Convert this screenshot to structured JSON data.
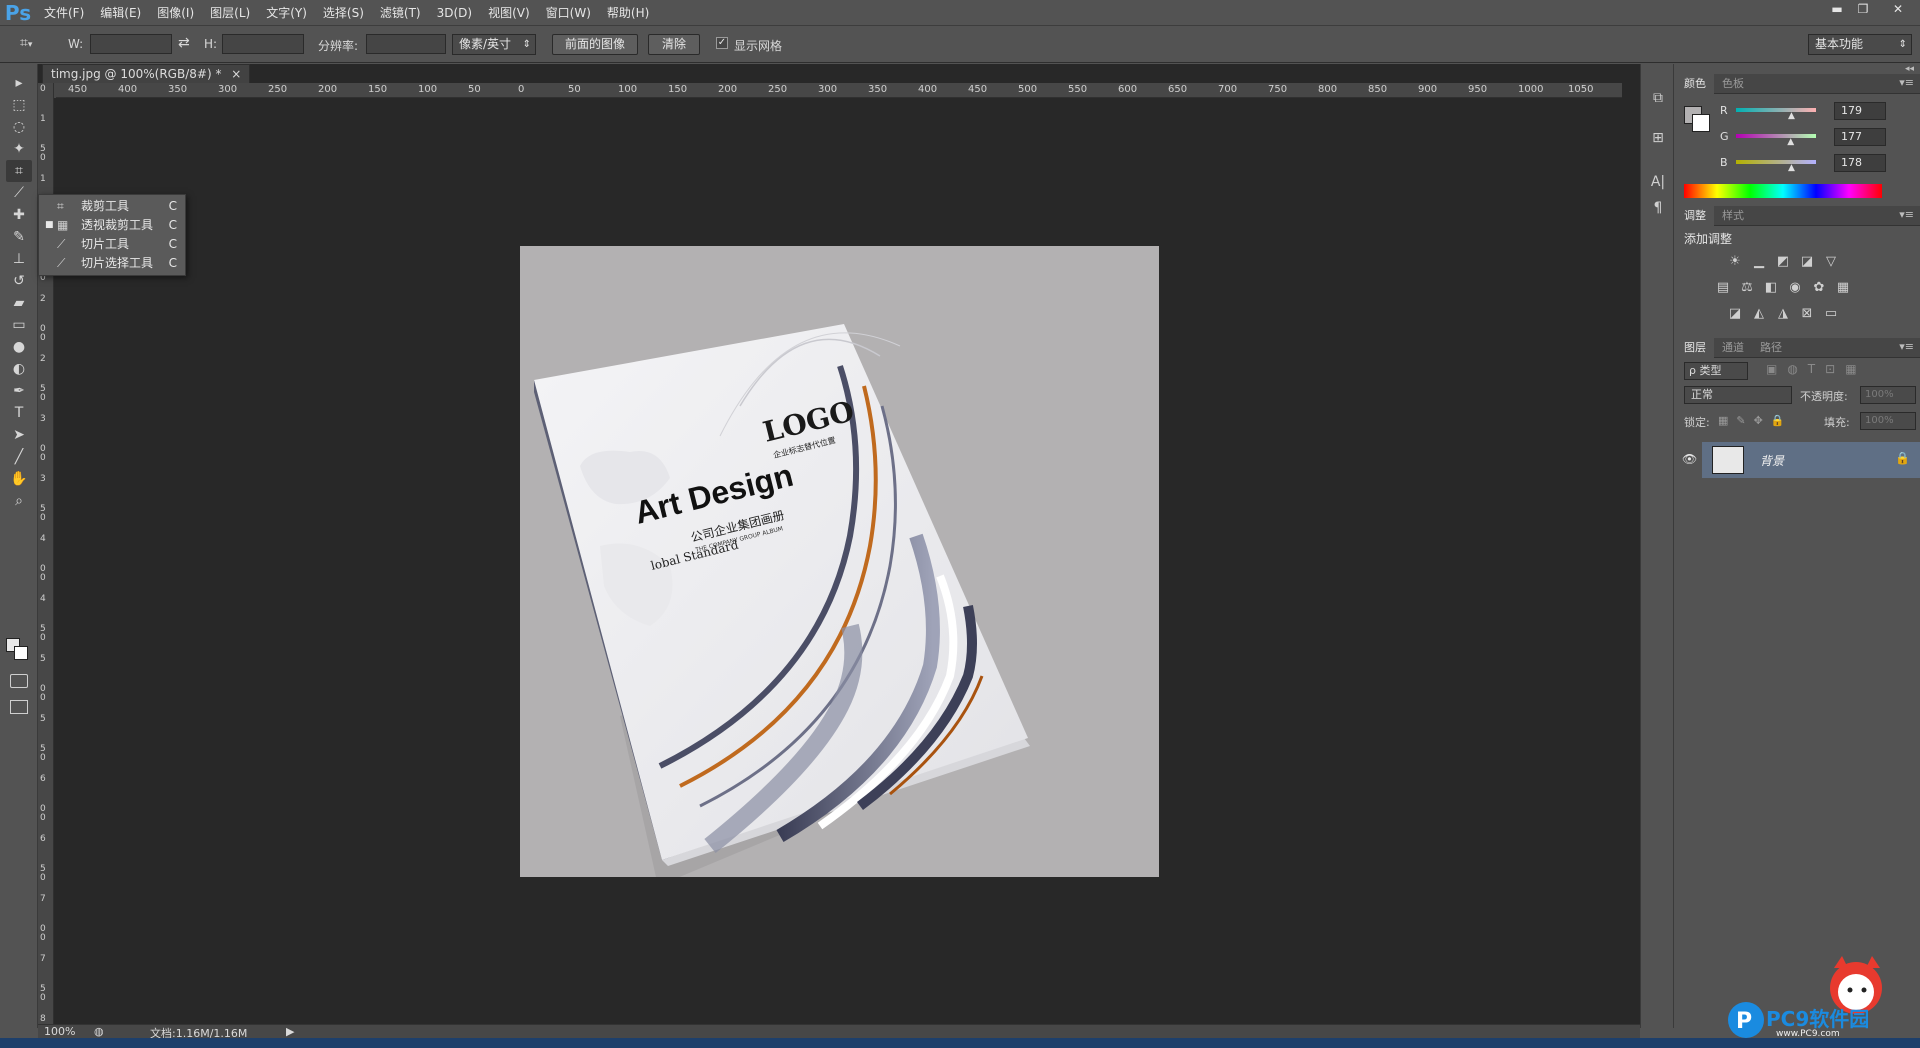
{
  "app": {
    "logo": "Ps"
  },
  "menu": [
    "文件(F)",
    "编辑(E)",
    "图像(I)",
    "图层(L)",
    "文字(Y)",
    "选择(S)",
    "滤镜(T)",
    "3D(D)",
    "视图(V)",
    "窗口(W)",
    "帮助(H)"
  ],
  "window_controls": {
    "minimize": "▬",
    "restore": "❐",
    "close": "✕"
  },
  "options": {
    "w_label": "W:",
    "h_label": "H:",
    "swap_glyph": "⇄",
    "resolution_label": "分辨率:",
    "unit_select": "像素/英寸",
    "front_image_button": "前面的图像",
    "clear_button": "清除",
    "show_grid_checked": "✓",
    "show_grid_label": "显示网格",
    "workspace": "基本功能"
  },
  "document": {
    "tab_title": "timg.jpg @ 100%(RGB/8#) *",
    "tab_close": "×",
    "ruler_top": [
      "450",
      "400",
      "350",
      "300",
      "250",
      "200",
      "150",
      "100",
      "50",
      "0",
      "50",
      "100",
      "150",
      "200",
      "250",
      "300",
      "350",
      "400",
      "450",
      "500",
      "550",
      "600",
      "650",
      "700",
      "750",
      "800",
      "850",
      "900",
      "950",
      "1000",
      "1050"
    ],
    "ruler_left": [
      "0",
      "1",
      "50",
      "1",
      "00",
      "1",
      "50",
      "2",
      "00",
      "2",
      "50",
      "3",
      "00",
      "3",
      "50",
      "4",
      "00",
      "4",
      "50",
      "5",
      "00",
      "5",
      "50",
      "6",
      "00",
      "6",
      "50",
      "7",
      "00",
      "7",
      "50",
      "8"
    ]
  },
  "cover": {
    "logo_text": "LOGO",
    "logo_sub": "企业标志替代位置",
    "title": "Art Design",
    "subtitle_cn": "公司企业集团画册",
    "subtitle_en": "THE COMPANY GROUP ALBUM",
    "tagline": "lobal Standard"
  },
  "flyout": [
    {
      "icon": "crop-icon",
      "glyph": "⌗",
      "label": "裁剪工具",
      "key": "C",
      "bullet": ""
    },
    {
      "icon": "perspective-crop-icon",
      "glyph": "▦",
      "label": "透视裁剪工具",
      "key": "C",
      "bullet": "■"
    },
    {
      "icon": "slice-icon",
      "glyph": "⟋",
      "label": "切片工具",
      "key": "C",
      "bullet": ""
    },
    {
      "icon": "slice-select-icon",
      "glyph": "⟋",
      "label": "切片选择工具",
      "key": "C",
      "bullet": ""
    }
  ],
  "tools": [
    {
      "name": "move-tool-icon",
      "glyph": "▸"
    },
    {
      "name": "marquee-tool-icon",
      "glyph": "⬚"
    },
    {
      "name": "lasso-tool-icon",
      "glyph": "◌"
    },
    {
      "name": "magic-wand-tool-icon",
      "glyph": "✦"
    },
    {
      "name": "crop-tool-icon",
      "glyph": "⌗"
    },
    {
      "name": "eyedropper-tool-icon",
      "glyph": "⟋"
    },
    {
      "name": "healing-brush-tool-icon",
      "glyph": "✚"
    },
    {
      "name": "brush-tool-icon",
      "glyph": "✎"
    },
    {
      "name": "stamp-tool-icon",
      "glyph": "⊥"
    },
    {
      "name": "history-brush-tool-icon",
      "glyph": "↺"
    },
    {
      "name": "eraser-tool-icon",
      "glyph": "▰"
    },
    {
      "name": "gradient-tool-icon",
      "glyph": "▭"
    },
    {
      "name": "blur-tool-icon",
      "glyph": "●"
    },
    {
      "name": "dodge-tool-icon",
      "glyph": "◐"
    },
    {
      "name": "pen-tool-icon",
      "glyph": "✒"
    },
    {
      "name": "type-tool-icon",
      "glyph": "T"
    },
    {
      "name": "path-selection-tool-icon",
      "glyph": "➤"
    },
    {
      "name": "line-tool-icon",
      "glyph": "╱"
    },
    {
      "name": "hand-tool-icon",
      "glyph": "✋"
    },
    {
      "name": "zoom-tool-icon",
      "glyph": "⌕"
    }
  ],
  "status": {
    "zoom": "100%",
    "doc": "文档:1.16M/1.16M",
    "arrow": "▶"
  },
  "panels": {
    "color_tabs": [
      "颜色",
      "色板"
    ],
    "panel_menu": "▾≡",
    "collapse": "◂◂",
    "r_label": "R",
    "g_label": "G",
    "b_label": "B",
    "r_value": "179",
    "g_value": "177",
    "b_value": "178",
    "r_level": 0.7,
    "g_level": 0.69,
    "b_level": 0.7,
    "fg_color": "#b3b1b2",
    "adjust_tabs": [
      "调整",
      "样式"
    ],
    "adjust_title": "添加调整",
    "layers_tabs": [
      "图层",
      "通道",
      "路径"
    ],
    "filter_kind": "ρ 类型",
    "blend_mode": "正常",
    "opacity_label": "不透明度:",
    "opacity_value": "100%",
    "lock_label": "锁定:",
    "fill_label": "填充:",
    "fill_value": "100%",
    "layer_name": "背景",
    "layer_eye": "👁",
    "layer_lock": "🔒"
  },
  "watermark": {
    "text": "PC9软件园",
    "url": "www.PC9.com"
  },
  "colors": {
    "accent": "#4aa3e8",
    "layer_selected": "#5f6f85",
    "canvas_bg": "#b3b1b2"
  }
}
